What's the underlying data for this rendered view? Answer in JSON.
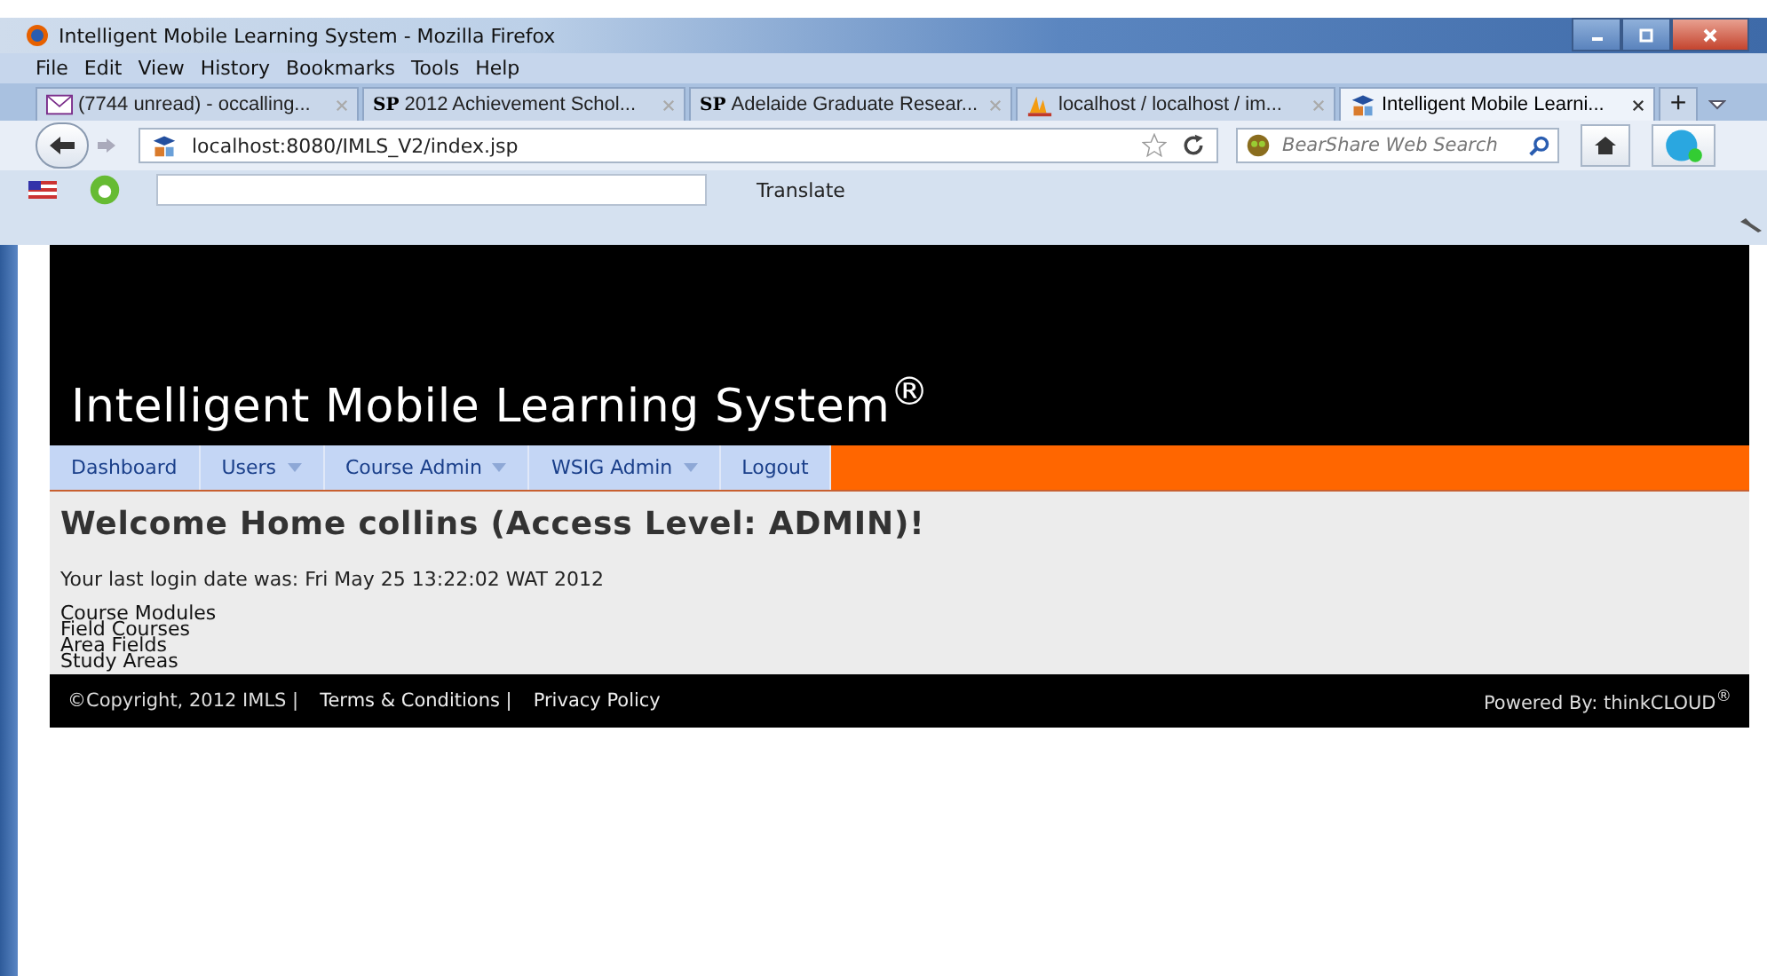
{
  "window": {
    "title": "Intelligent Mobile Learning System - Mozilla Firefox"
  },
  "menu": [
    "File",
    "Edit",
    "View",
    "History",
    "Bookmarks",
    "Tools",
    "Help"
  ],
  "tabs": [
    {
      "label": "(7744 unread) - occalling...",
      "kind": "mail",
      "selected": false
    },
    {
      "label": "2012 Achievement Schol...",
      "kind": "sp",
      "icon_text": "SP",
      "selected": false
    },
    {
      "label": "Adelaide Graduate Resear...",
      "kind": "sp",
      "icon_text": "SP",
      "selected": false
    },
    {
      "label": "localhost / localhost / im...",
      "kind": "pma",
      "selected": false
    },
    {
      "label": "Intelligent Mobile Learni...",
      "kind": "site",
      "selected": true
    }
  ],
  "new_tab": "+",
  "address": {
    "value": "localhost:8080/IMLS_V2/index.jsp"
  },
  "search": {
    "placeholder": "BearShare Web Search"
  },
  "addon_bar": {
    "translate": "Translate"
  },
  "site": {
    "title": "Intelligent Mobile Learning System$^{®}$",
    "nav": [
      {
        "label": "Dashboard",
        "has_menu": false
      },
      {
        "label": "Users",
        "has_menu": true
      },
      {
        "label": "Course Admin",
        "has_menu": true
      },
      {
        "label": "WSIG Admin",
        "has_menu": true
      },
      {
        "label": "Logout",
        "has_menu": false
      }
    ],
    "welcome": "Welcome Home collins (Access Level: ADMIN)!",
    "last_login": "Your last login date was: Fri May 25 13:22:02 WAT 2012",
    "links": [
      "Course Modules",
      "Field Courses",
      "Area Fields",
      "Study Areas"
    ],
    "footer": {
      "copyright": "©Copyright, 2012 IMLS |",
      "links": [
        "Terms & Conditions |",
        "Privacy Policy"
      ],
      "powered": "Powered By: thinkCLOUD$^{®}$"
    }
  }
}
